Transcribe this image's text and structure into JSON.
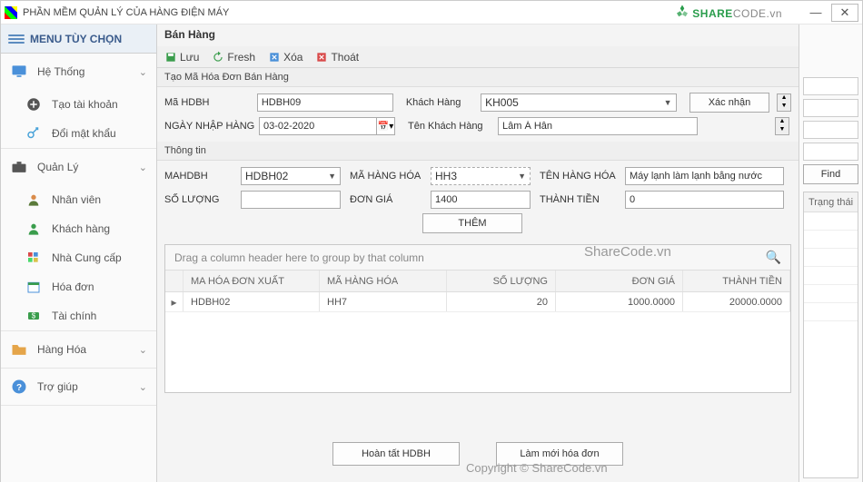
{
  "window": {
    "title": "PHẦN MỀM QUẢN LÝ CỦA HÀNG ĐIỆN MÁY",
    "brand_a": "SHARE",
    "brand_b": "CODE",
    "brand_c": ".vn"
  },
  "sidebar": {
    "header": "MENU TÙY CHỌN",
    "groups": [
      {
        "label": "Hệ Thống",
        "items": [
          {
            "label": "Tạo tài khoản"
          },
          {
            "label": "Đổi mật khẩu"
          }
        ]
      },
      {
        "label": "Quản Lý",
        "items": [
          {
            "label": "Nhân viên"
          },
          {
            "label": "Khách hàng"
          },
          {
            "label": "Nhà Cung cấp"
          },
          {
            "label": "Hóa đơn"
          },
          {
            "label": "Tài chính"
          }
        ]
      },
      {
        "label": "Hàng Hóa",
        "items": []
      },
      {
        "label": "Trợ giúp",
        "items": []
      }
    ]
  },
  "page": {
    "title": "Bán Hàng",
    "toolbar": {
      "save": "Lưu",
      "fresh": "Fresh",
      "delete": "Xóa",
      "exit": "Thoát"
    },
    "section1_title": "Tạo Mã Hóa Đơn Bán Hàng",
    "section2_title": "Thông tin",
    "labels": {
      "ma_hdbh": "Mã HDBH",
      "khach_hang": "Khách Hàng",
      "xac_nhan": "Xác nhận",
      "ngay_nhap": "NGÀY NHẬP HÀNG",
      "ten_kh": "Tên Khách Hàng",
      "mahdbh": "MAHDBH",
      "ma_hang": "MÃ HÀNG HÓA",
      "ten_hang": "TÊN HÀNG HÓA",
      "so_luong": "SỐ LƯỢNG",
      "don_gia": "ĐƠN GIÁ",
      "thanh_tien": "THÀNH TIỀN",
      "them": "THÊM"
    },
    "values": {
      "ma_hdbh": "HDBH09",
      "khach_hang": "KH005",
      "ngay_nhap": "03-02-2020",
      "ten_kh": "Lâm Á Hân",
      "mahdbh": "HDBH02",
      "ma_hang": "HH3",
      "ten_hang": "Máy lạnh làm lạnh bằng nước",
      "so_luong": "",
      "don_gia": "1400",
      "thanh_tien": "0"
    },
    "grid": {
      "group_hint": "Drag a column header here to group by that column",
      "cols": [
        "MA HÓA ĐƠN XUẤT",
        "MÃ HÀNG HÓA",
        "SỐ LƯỢNG",
        "ĐƠN GIÁ",
        "THÀNH TIỀN"
      ],
      "rows": [
        {
          "c1": "HDBH02",
          "c2": "HH7",
          "c3": "20",
          "c4": "1000.0000",
          "c5": "20000.0000"
        }
      ]
    },
    "footer": {
      "complete": "Hoàn tất HDBH",
      "refresh": "Làm mới hóa đơn"
    }
  },
  "rightpane": {
    "find": "Find",
    "status": "Trạng thái"
  },
  "watermark": {
    "a": "ShareCode.vn",
    "b": "Copyright © ShareCode.vn"
  }
}
